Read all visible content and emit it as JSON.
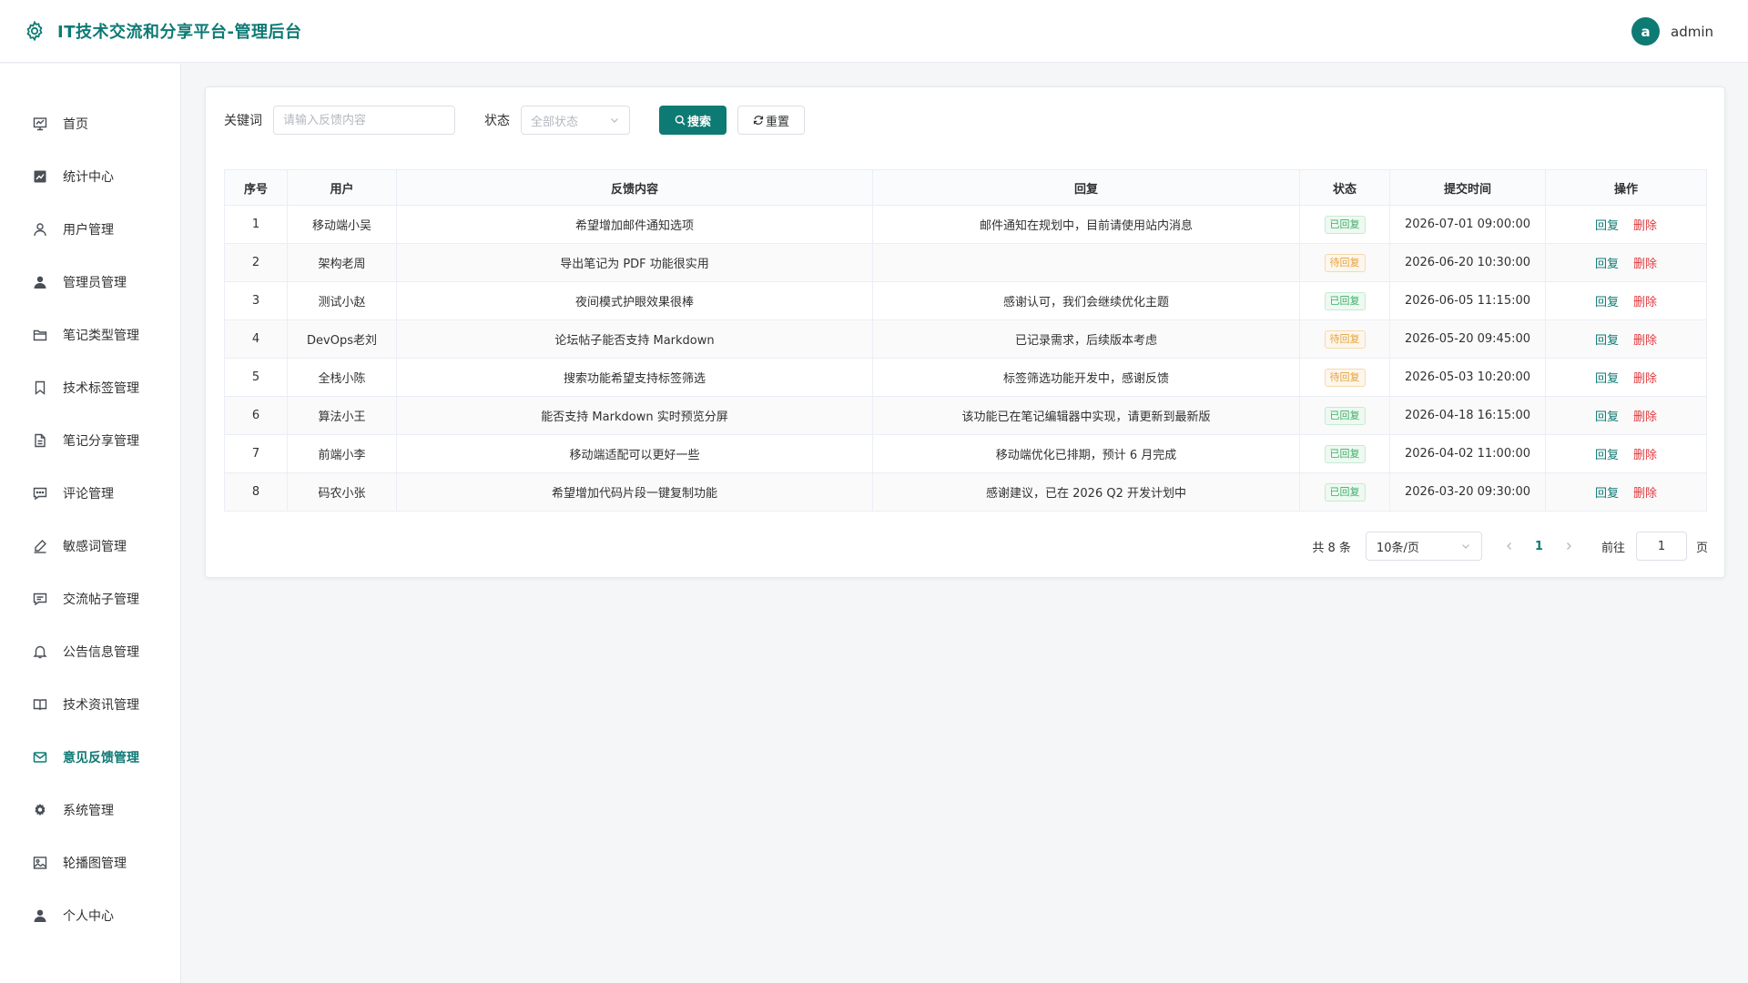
{
  "header": {
    "title": "IT技术交流和分享平台-管理后台",
    "avatar_letter": "a",
    "username": "admin",
    "accent": "#0e7a74"
  },
  "sidebar": {
    "items": [
      {
        "label": "首页",
        "icon": "dashboard-icon"
      },
      {
        "label": "统计中心",
        "icon": "chart-icon"
      },
      {
        "label": "用户管理",
        "icon": "user-outline-icon"
      },
      {
        "label": "管理员管理",
        "icon": "user-filled-icon"
      },
      {
        "label": "笔记类型管理",
        "icon": "folder-icon"
      },
      {
        "label": "技术标签管理",
        "icon": "bookmark-icon"
      },
      {
        "label": "笔记分享管理",
        "icon": "document-icon"
      },
      {
        "label": "评论管理",
        "icon": "comment-icon"
      },
      {
        "label": "敏感词管理",
        "icon": "pen-icon"
      },
      {
        "label": "交流帖子管理",
        "icon": "message-icon"
      },
      {
        "label": "公告信息管理",
        "icon": "bell-icon"
      },
      {
        "label": "技术资讯管理",
        "icon": "book-icon"
      },
      {
        "label": "意见反馈管理",
        "icon": "mail-icon"
      },
      {
        "label": "系统管理",
        "icon": "gear-icon"
      },
      {
        "label": "轮播图管理",
        "icon": "image-icon"
      },
      {
        "label": "个人中心",
        "icon": "person-icon"
      }
    ],
    "active": "意见反馈管理"
  },
  "filter": {
    "keyword_label": "关键词",
    "keyword_placeholder": "请输入反馈内容",
    "keyword_value": "",
    "status_label": "状态",
    "status_placeholder": "全部状态",
    "search_label": "搜索",
    "reset_label": "重置"
  },
  "table": {
    "columns": [
      "序号",
      "用户",
      "反馈内容",
      "回复",
      "状态",
      "提交时间",
      "操作"
    ],
    "rows": [
      {
        "idx": "1",
        "user": "移动端小吴",
        "content": "希望增加邮件通知选项",
        "reply": "邮件通知在规划中，目前请使用站内消息",
        "status": "已回复",
        "status_type": "done",
        "time": "2026-07-01 09:00:00"
      },
      {
        "idx": "2",
        "user": "架构老周",
        "content": "导出笔记为 PDF 功能很实用",
        "reply": "",
        "status": "待回复",
        "status_type": "wait",
        "time": "2026-06-20 10:30:00"
      },
      {
        "idx": "3",
        "user": "测试小赵",
        "content": "夜间模式护眼效果很棒",
        "reply": "感谢认可，我们会继续优化主题",
        "status": "已回复",
        "status_type": "done",
        "time": "2026-06-05 11:15:00"
      },
      {
        "idx": "4",
        "user": "DevOps老刘",
        "content": "论坛帖子能否支持 Markdown",
        "reply": "已记录需求，后续版本考虑",
        "status": "待回复",
        "status_type": "wait",
        "time": "2026-05-20 09:45:00"
      },
      {
        "idx": "5",
        "user": "全栈小陈",
        "content": "搜索功能希望支持标签筛选",
        "reply": "标签筛选功能开发中，感谢反馈",
        "status": "待回复",
        "status_type": "wait",
        "time": "2026-05-03 10:20:00"
      },
      {
        "idx": "6",
        "user": "算法小王",
        "content": "能否支持 Markdown 实时预览分屏",
        "reply": "该功能已在笔记编辑器中实现，请更新到最新版",
        "status": "已回复",
        "status_type": "done",
        "time": "2026-04-18 16:15:00"
      },
      {
        "idx": "7",
        "user": "前端小李",
        "content": "移动端适配可以更好一些",
        "reply": "移动端优化已排期，预计 6 月完成",
        "status": "已回复",
        "status_type": "done",
        "time": "2026-04-02 11:00:00"
      },
      {
        "idx": "8",
        "user": "码农小张",
        "content": "希望增加代码片段一键复制功能",
        "reply": "感谢建议，已在 2026 Q2 开发计划中",
        "status": "已回复",
        "status_type": "done",
        "time": "2026-03-20 09:30:00"
      }
    ],
    "reply_label": "回复",
    "delete_label": "删除"
  },
  "pagination": {
    "total_text": "共 8 条",
    "page_size": "10条/页",
    "current_page": "1",
    "goto_label": "前往",
    "goto_value": "1",
    "page_unit": "页"
  }
}
